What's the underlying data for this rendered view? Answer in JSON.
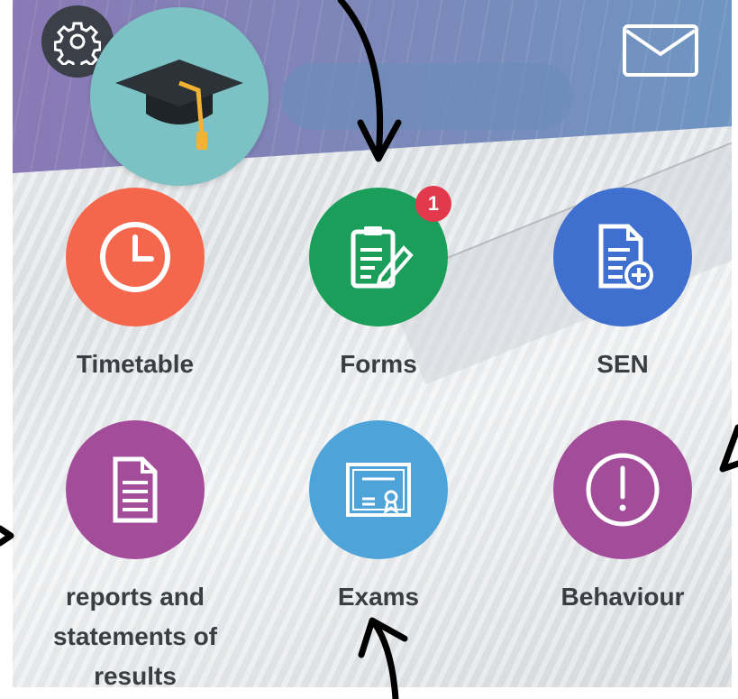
{
  "header": {
    "settings_icon": "gear-icon",
    "mail_icon": "envelope-icon",
    "logo_icon": "graduation-cap-icon"
  },
  "tiles": [
    {
      "label": "Timetable",
      "icon": "clock-icon",
      "color": "#f5674c"
    },
    {
      "label": "Forms",
      "icon": "form-edit-icon",
      "color": "#1b9e5a",
      "badge": "1"
    },
    {
      "label": "SEN",
      "icon": "document-plus-icon",
      "color": "#3f6fcf"
    },
    {
      "label": "reports and statements of results",
      "icon": "document-icon",
      "color": "#a34d9a"
    },
    {
      "label": "Exams",
      "icon": "certificate-icon",
      "color": "#4ea3d9"
    },
    {
      "label": "Behaviour",
      "icon": "exclamation-icon",
      "color": "#a34d9a"
    }
  ],
  "colors": {
    "badge": "#e23a4c",
    "label_text": "#3a3d42"
  }
}
